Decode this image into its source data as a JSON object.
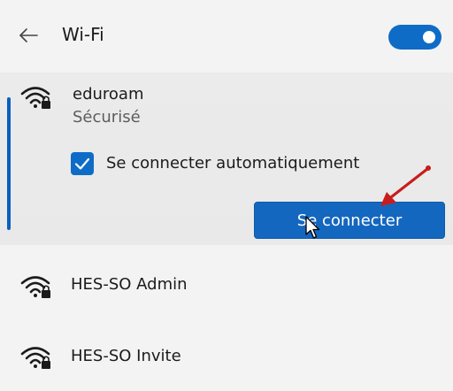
{
  "header": {
    "title": "Wi-Fi",
    "toggle_on": true
  },
  "selected_network": {
    "name": "eduroam",
    "status": "Sécurisé",
    "auto_connect_label": "Se connecter automatiquement",
    "auto_connect_checked": true,
    "connect_button_label": "Se connecter"
  },
  "networks": [
    {
      "name": "HES-SO Admin"
    },
    {
      "name": "HES-SO Invite"
    }
  ],
  "colors": {
    "accent": "#0e6cc7",
    "annotation_arrow": "#c81d1d"
  }
}
